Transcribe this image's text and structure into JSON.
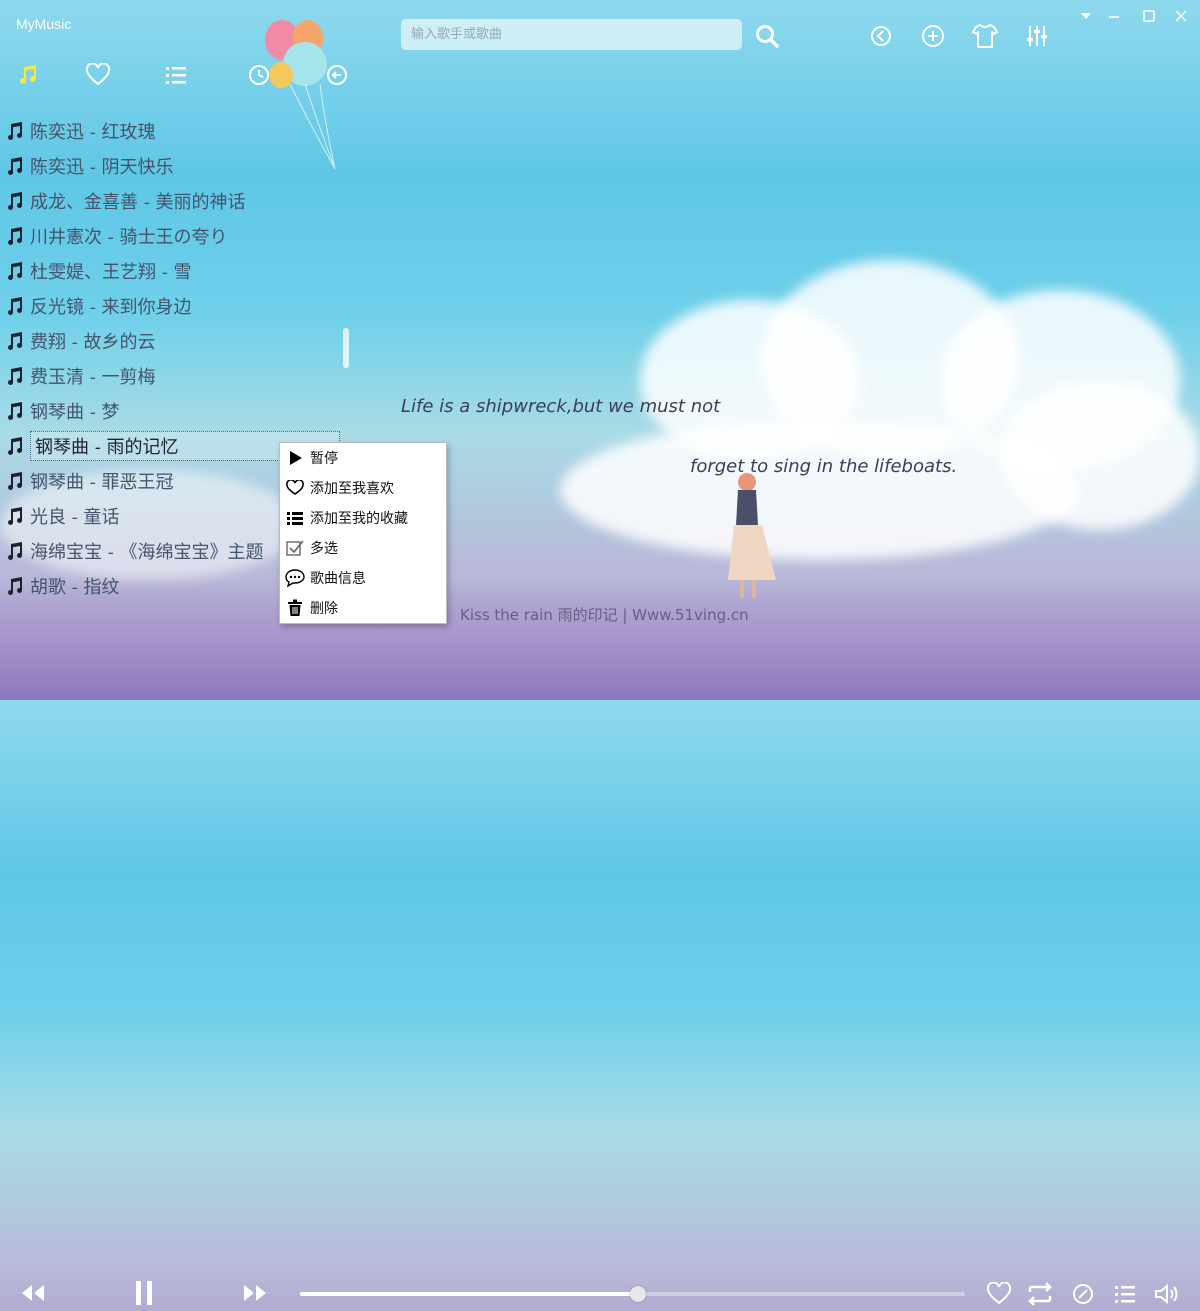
{
  "app": {
    "title": "MyMusic"
  },
  "search": {
    "placeholder": "输入歌手或歌曲"
  },
  "colors": {
    "accent": "#f5e642",
    "text": "#44546a",
    "menu_bg": "#ffffff"
  },
  "top_nav": {
    "items": [
      {
        "name": "music-note-icon",
        "active": true
      },
      {
        "name": "heart-icon"
      },
      {
        "name": "list-icon"
      },
      {
        "name": "history-icon"
      },
      {
        "name": "back-arrow-icon"
      }
    ]
  },
  "toolbar": {
    "items": [
      "search-icon",
      "back-icon",
      "add-icon",
      "skin-icon",
      "equalizer-icon"
    ]
  },
  "window": {
    "controls": [
      "dropdown-icon",
      "minimize-icon",
      "maximize-icon",
      "close-icon"
    ]
  },
  "songs": [
    {
      "title": "陈奕迅 - 红玫瑰"
    },
    {
      "title": "陈奕迅 - 阴天快乐"
    },
    {
      "title": "成龙、金喜善 - 美丽的神话"
    },
    {
      "title": "川井憲次 - 骑士王の夸り"
    },
    {
      "title": "杜雯媞、王艺翔 - 雪"
    },
    {
      "title": "反光镜 - 来到你身边"
    },
    {
      "title": "费翔 - 故乡的云"
    },
    {
      "title": "费玉清 - 一剪梅"
    },
    {
      "title": "钢琴曲 - 梦"
    },
    {
      "title": "钢琴曲 - 雨的记忆",
      "selected": true
    },
    {
      "title": "钢琴曲 - 罪恶王冠"
    },
    {
      "title": "光良 - 童话"
    },
    {
      "title": "海绵宝宝 - 《海绵宝宝》主题"
    },
    {
      "title": "胡歌 - 指纹"
    }
  ],
  "quote": {
    "line1": "Life is a shipwreck,but we must not",
    "line2": "forget to sing in the lifeboats."
  },
  "now_playing": {
    "ticker": "Kiss the rain 雨的印记 | Www.51ving.cn"
  },
  "context_menu": {
    "items": [
      {
        "icon": "play-icon",
        "label": "暂停"
      },
      {
        "icon": "heart-icon",
        "label": "添加至我喜欢"
      },
      {
        "icon": "list-icon",
        "label": "添加至我的收藏"
      },
      {
        "icon": "checkbox-icon",
        "label": "多选"
      },
      {
        "icon": "info-bubble-icon",
        "label": "歌曲信息"
      },
      {
        "icon": "trash-icon",
        "label": "删除"
      }
    ]
  },
  "player": {
    "progress": 0.508,
    "controls": [
      "rewind-icon",
      "pause-icon",
      "fast-forward-icon"
    ],
    "right_controls": [
      "heart-icon",
      "repeat-icon",
      "lyrics-icon",
      "playlist-icon",
      "volume-icon"
    ]
  }
}
